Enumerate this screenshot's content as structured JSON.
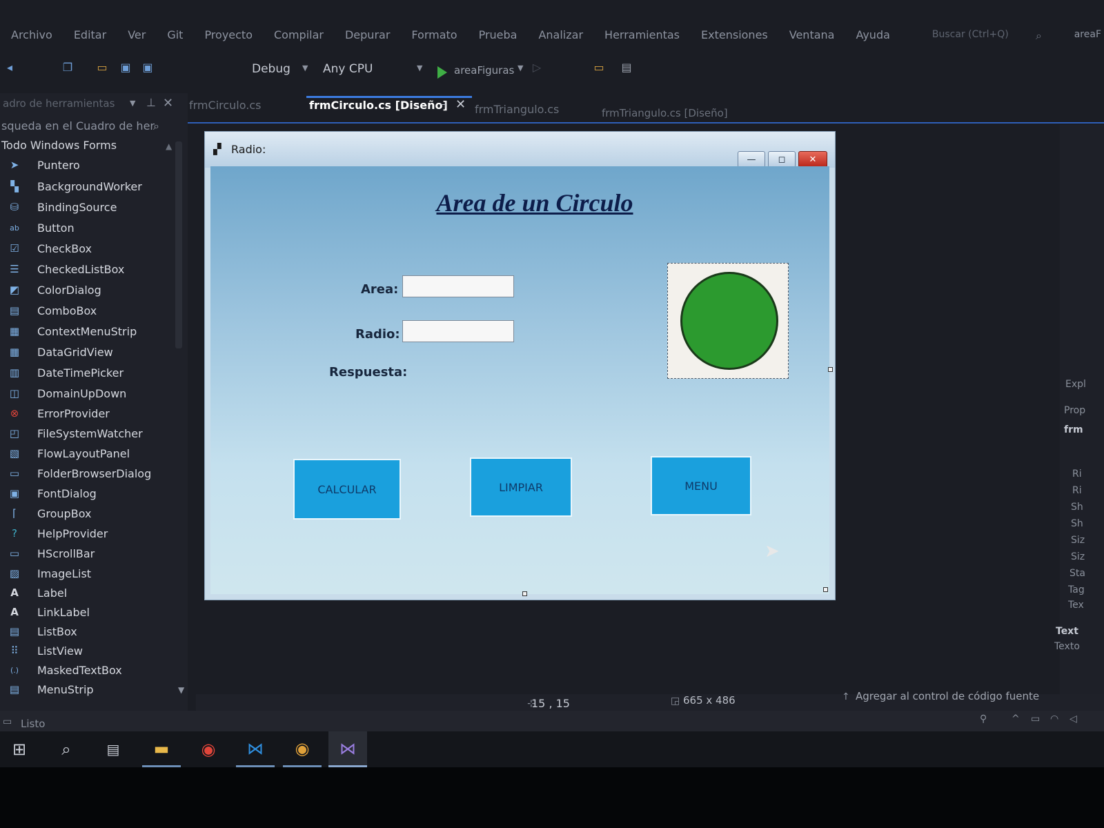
{
  "menu": {
    "items": [
      "Archivo",
      "Editar",
      "Ver",
      "Git",
      "Proyecto",
      "Compilar",
      "Depurar",
      "Formato",
      "Prueba",
      "Analizar",
      "Herramientas",
      "Extensiones",
      "Ventana",
      "Ayuda"
    ],
    "search_placeholder": "Buscar (Ctrl+Q)",
    "project_name": "areaF"
  },
  "toolbar": {
    "config": "Debug",
    "platform": "Any CPU",
    "start_project": "areaFiguras"
  },
  "toolbox": {
    "title": "adro de herramientas",
    "search_placeholder": "squeda en el Cuadro de her",
    "category": "Todo Windows Forms",
    "items": [
      {
        "label": "Puntero",
        "icon": "pointer-icon"
      },
      {
        "label": "BackgroundWorker",
        "icon": "background-worker-icon"
      },
      {
        "label": "BindingSource",
        "icon": "binding-source-icon"
      },
      {
        "label": "Button",
        "icon": "button-icon"
      },
      {
        "label": "CheckBox",
        "icon": "checkbox-icon"
      },
      {
        "label": "CheckedListBox",
        "icon": "checked-list-box-icon"
      },
      {
        "label": "ColorDialog",
        "icon": "color-dialog-icon"
      },
      {
        "label": "ComboBox",
        "icon": "combobox-icon"
      },
      {
        "label": "ContextMenuStrip",
        "icon": "context-menu-strip-icon"
      },
      {
        "label": "DataGridView",
        "icon": "data-grid-view-icon"
      },
      {
        "label": "DateTimePicker",
        "icon": "date-time-picker-icon"
      },
      {
        "label": "DomainUpDown",
        "icon": "domain-up-down-icon"
      },
      {
        "label": "ErrorProvider",
        "icon": "error-provider-icon"
      },
      {
        "label": "FileSystemWatcher",
        "icon": "file-system-watcher-icon"
      },
      {
        "label": "FlowLayoutPanel",
        "icon": "flow-layout-panel-icon"
      },
      {
        "label": "FolderBrowserDialog",
        "icon": "folder-browser-dialog-icon"
      },
      {
        "label": "FontDialog",
        "icon": "font-dialog-icon"
      },
      {
        "label": "GroupBox",
        "icon": "group-box-icon"
      },
      {
        "label": "HelpProvider",
        "icon": "help-provider-icon"
      },
      {
        "label": "HScrollBar",
        "icon": "hscrollbar-icon"
      },
      {
        "label": "ImageList",
        "icon": "image-list-icon"
      },
      {
        "label": "Label",
        "icon": "label-icon"
      },
      {
        "label": "LinkLabel",
        "icon": "link-label-icon"
      },
      {
        "label": "ListBox",
        "icon": "list-box-icon"
      },
      {
        "label": "ListView",
        "icon": "list-view-icon"
      },
      {
        "label": "MaskedTextBox",
        "icon": "masked-text-box-icon"
      },
      {
        "label": "MenuStrip",
        "icon": "menu-strip-icon"
      }
    ]
  },
  "tabs": [
    {
      "label": "frmCirculo.cs",
      "active": false
    },
    {
      "label": "frmCirculo.cs [Diseño]",
      "active": true
    },
    {
      "label": "frmTriangulo.cs",
      "active": false
    },
    {
      "label": "frmTriangulo.cs [Diseño]",
      "active": false
    }
  ],
  "form": {
    "title": "Radio:",
    "heading": "Area de un Circulo",
    "labels": {
      "area": "Area:",
      "radio": "Radio:",
      "respuesta": "Respuesta:"
    },
    "inputs": {
      "area_value": "",
      "radio_value": ""
    },
    "buttons": {
      "calcular": "CALCULAR",
      "limpiar": "LIMPIAR",
      "menu": "MENU"
    },
    "circle_color": "#2c9a2f",
    "window_buttons": {
      "minimize": "—",
      "maximize": "◻",
      "close": "✕"
    }
  },
  "right_panel": {
    "texts": [
      "Expl",
      "Prop",
      "frm",
      "Ri",
      "Ri",
      "Sh",
      "Sh",
      "Siz",
      "Siz",
      "Sta",
      "Tag",
      "Tex",
      "Text",
      "Texto"
    ]
  },
  "status": {
    "ready": "Listo",
    "position": "15 , 15",
    "size": "665 x 486",
    "source_control": "Agregar al control de código fuente"
  },
  "taskbar": {
    "items": [
      "windows-start-icon",
      "search-icon",
      "task-view-icon",
      "file-explorer-icon",
      "chrome-icon",
      "vscode-icon",
      "chrome-canary-icon",
      "visual-studio-icon"
    ]
  },
  "colors": {
    "accent": "#3c7be0",
    "form_button": "#1aa0dd",
    "ide_background": "#1b1d24"
  }
}
